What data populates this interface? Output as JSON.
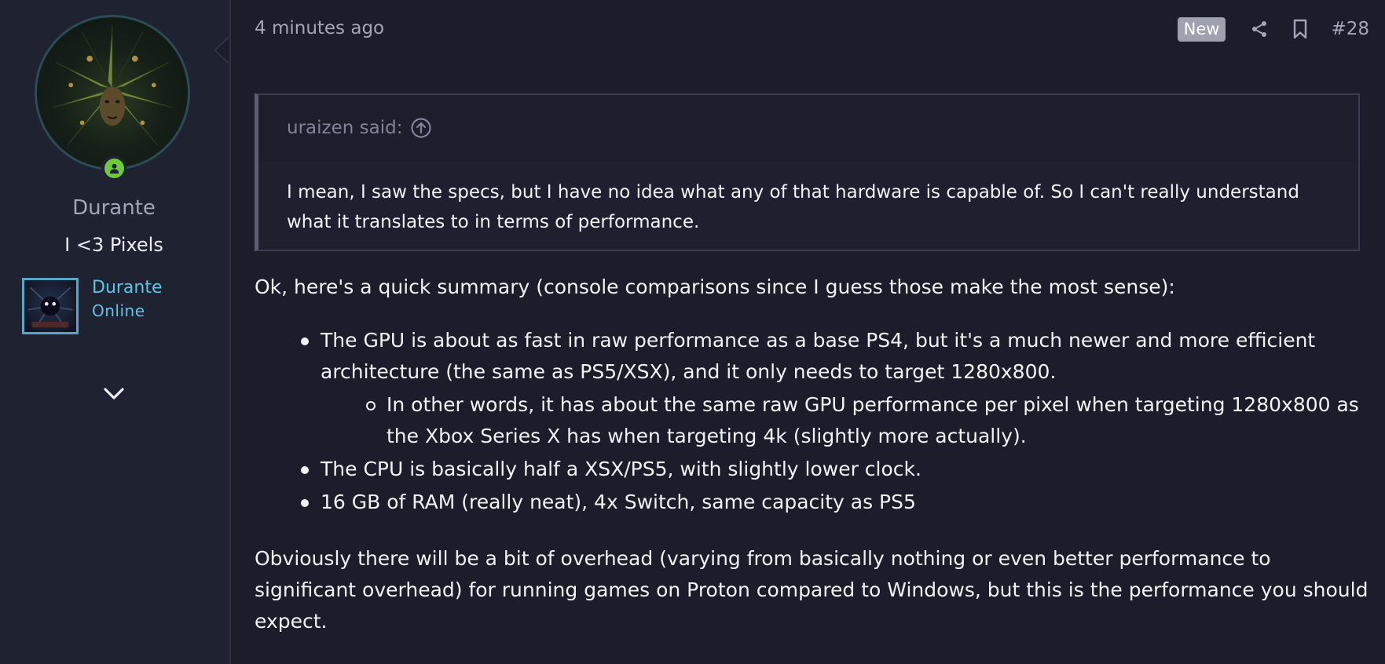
{
  "user": {
    "name": "Durante",
    "title": "I <3 Pixels",
    "steam_name": "Durante",
    "steam_status": "Online"
  },
  "post": {
    "timestamp": "4 minutes ago",
    "badge": "New",
    "number": "#28"
  },
  "quote": {
    "author": "uraizen said:",
    "text": "I mean, I saw the specs, but I have no idea what any of that hardware is capable of. So I can't really understand what it translates to in terms of performance."
  },
  "message": {
    "intro": "Ok, here's a quick summary (console comparisons since I guess those make the most sense):",
    "bullets": [
      {
        "text": "The GPU is about as fast in raw performance as a base PS4, but it's a much newer and more efficient architecture (the same as PS5/XSX), and it only needs to target 1280x800.",
        "sub": "In other words, it has about the same raw GPU performance per pixel when targeting 1280x800 as the Xbox Series X has when targeting 4k (slightly more actually)."
      },
      {
        "text": "The CPU is basically half a XSX/PS5, with slightly lower clock."
      },
      {
        "text": "16 GB of RAM (really neat), 4x Switch, same capacity as PS5"
      }
    ],
    "outro": "Obviously there will be a bit of overhead (varying from basically nothing or even better performance to significant overhead) for running games on Proton compared to Windows, but this is the performance you should expect."
  },
  "icons": {
    "share": "share-icon",
    "bookmark": "bookmark-icon",
    "quote_jump": "arrow-up-circle-icon",
    "online": "user-icon",
    "expand": "chevron-down-icon"
  },
  "colors": {
    "background": "#1b1d2a",
    "sidebar": "#1f2231",
    "accent_link": "#5fc4e6",
    "online": "#6fc93a",
    "badge": "#9ea1ae"
  }
}
